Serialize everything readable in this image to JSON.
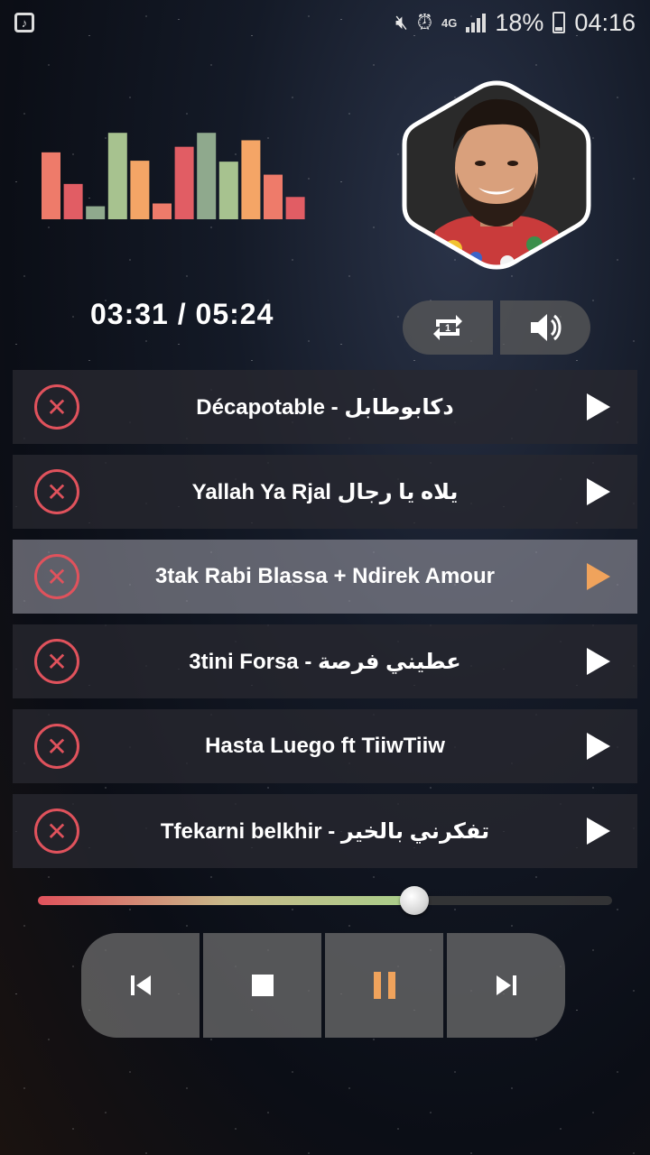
{
  "status_bar": {
    "time": "04:16",
    "battery": "18%",
    "network": "4G",
    "left_icon": "music-note-icon",
    "icons": [
      "mute-icon",
      "alarm-icon",
      "signal-icon",
      "battery-icon"
    ]
  },
  "equalizer": {
    "levels": [
      0.72,
      0.38,
      0.14,
      0.93,
      0.63,
      0.17,
      0.78,
      0.93,
      0.62,
      0.85,
      0.48,
      0.24
    ],
    "colors": [
      "#ee7b6a",
      "#e15d64",
      "#8fa98d",
      "#a7c28f",
      "#f4a566",
      "#ee7b6a",
      "#e15d64",
      "#8fa98d",
      "#a7c28f",
      "#f4a566",
      "#ee7b6a",
      "#e15d64"
    ]
  },
  "player": {
    "time_display": "03:31 / 05:24",
    "progress": 0.655,
    "repeat_icon": "repeat-one-icon",
    "volume_icon": "volume-icon"
  },
  "playlist": [
    {
      "title": "Décapotable - دكابوطابل",
      "active": false
    },
    {
      "title": "Yallah Ya Rjal يلاه يا رجال",
      "active": false
    },
    {
      "title": "3tak Rabi Blassa + Ndirek Amour",
      "active": true
    },
    {
      "title": "3tini Forsa - عطيني فرصة",
      "active": false
    },
    {
      "title": "Hasta Luego ft TiiwTiiw",
      "active": false
    },
    {
      "title": "Tfekarni belkhir - تفكرني بالخير",
      "active": false
    }
  ],
  "controls": {
    "icons": [
      "previous-icon",
      "stop-icon",
      "pause-icon",
      "next-icon"
    ],
    "accent": "#f0a35c"
  },
  "colors": {
    "delete": "#e0525c",
    "active_play": "#f0a35c"
  }
}
